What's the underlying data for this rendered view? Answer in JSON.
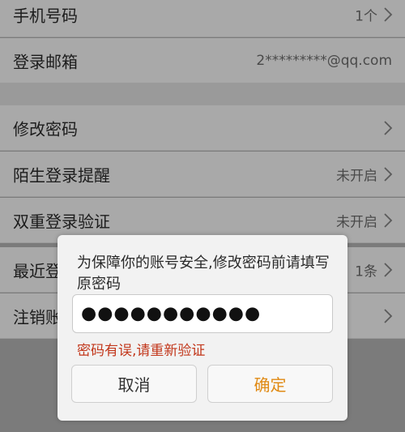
{
  "rows": [
    {
      "label": "手机号码",
      "value": "1个"
    },
    {
      "label": "登录邮箱",
      "value": "2*********@qq.com"
    },
    {
      "label": "修改密码",
      "value": ""
    },
    {
      "label": "陌生登录提醒",
      "value": "未开启"
    },
    {
      "label": "双重登录验证",
      "value": "未开启"
    },
    {
      "label": "最近登",
      "value": "1条"
    },
    {
      "label": "注销账",
      "value": ""
    }
  ],
  "dialog": {
    "message": "为保障你的账号安全,修改密码前请填写原密码",
    "password_mask": "●●●●●●●●●●●",
    "error": "密码有误,请重新验证",
    "cancel_label": "取消",
    "ok_label": "确定",
    "accent": "#e08a14",
    "error_color": "#c2371b"
  },
  "icons": {
    "chevron": "chevron-right-icon"
  }
}
